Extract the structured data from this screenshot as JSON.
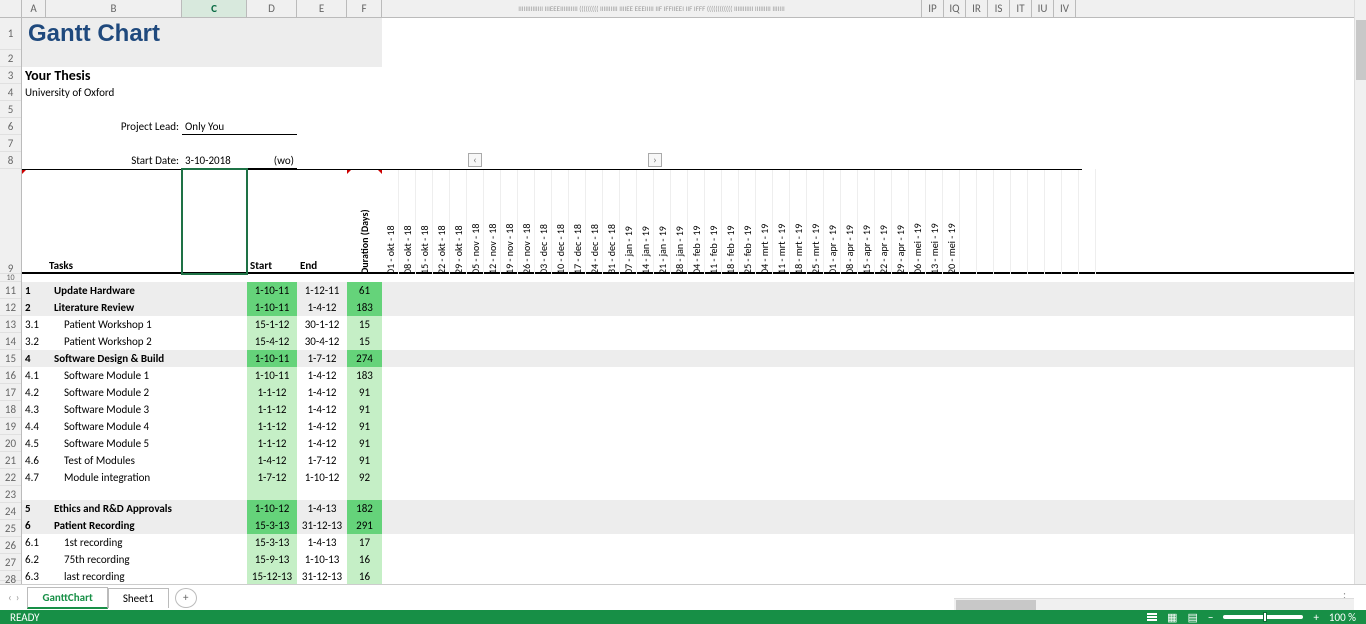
{
  "main_title": "Gantt Chart",
  "subtitle": "Your Thesis",
  "subsubtitle": "University of Oxford",
  "project_lead_label": "Project Lead:",
  "project_lead_value": "Only You",
  "start_date_label": "Start Date:",
  "start_date_value": "3-10-2018",
  "start_date_suffix": "(wo)",
  "headers": {
    "tasks": "Tasks",
    "start": "Start",
    "end": "End",
    "duration": "Duration (Days)"
  },
  "col_letters": [
    "A",
    "B",
    "C",
    "D",
    "E",
    "F"
  ],
  "col_far_letters": [
    "IP",
    "IQ",
    "IR",
    "IS",
    "IT",
    "IU",
    "IV"
  ],
  "row_numbers": [
    "1",
    "2",
    "3",
    "4",
    "5",
    "6",
    "7",
    "8",
    "9",
    "10",
    "11",
    "12",
    "13",
    "14",
    "15",
    "16",
    "17",
    "18",
    "19",
    "20",
    "21",
    "22",
    "23",
    "24",
    "25",
    "26",
    "27",
    "28"
  ],
  "scroll_left": "‹",
  "scroll_right": "›",
  "timeline_labels": [
    "01 - okt - 18",
    "08 - okt - 18",
    "15 - okt - 18",
    "22 - okt - 18",
    "29 - okt - 18",
    "05 - nov - 18",
    "12 - nov - 18",
    "19 - nov - 18",
    "26 - nov - 18",
    "03 - dec - 18",
    "10 - dec - 18",
    "17 - dec - 18",
    "24 - dec - 18",
    "31 - dec - 18",
    "07 - jan - 19",
    "14 - jan - 19",
    "21 - jan - 19",
    "28 - jan - 19",
    "04 - feb - 19",
    "11 - feb - 19",
    "18 - feb - 19",
    "25 - feb - 19",
    "04 - mrt - 19",
    "11 - mrt - 19",
    "18 - mrt - 19",
    "25 - mrt - 19",
    "01 - apr - 19",
    "08 - apr - 19",
    "15 - apr - 19",
    "22 - apr - 19",
    "29 - apr - 19",
    "06 - mei - 19",
    "13 - mei - 19",
    "20 - mei - 19"
  ],
  "rows": [
    {
      "n": "1",
      "task": "Update Hardware",
      "start": "1-10-11",
      "end": "1-12-11",
      "dur": "61",
      "bold": true,
      "grey": true,
      "greendark": true
    },
    {
      "n": "2",
      "task": "Literature Review",
      "start": "1-10-11",
      "end": "1-4-12",
      "dur": "183",
      "bold": true,
      "grey": true,
      "greendark": true
    },
    {
      "n": "3.1",
      "task": "Patient Workshop 1",
      "start": "15-1-12",
      "end": "30-1-12",
      "dur": "15",
      "bold": false,
      "grey": false,
      "greendark": false
    },
    {
      "n": "3.2",
      "task": "Patient Workshop 2",
      "start": "15-4-12",
      "end": "30-4-12",
      "dur": "15",
      "bold": false,
      "grey": false,
      "greendark": false
    },
    {
      "n": "4",
      "task": "Software Design & Build",
      "start": "1-10-11",
      "end": "1-7-12",
      "dur": "274",
      "bold": true,
      "grey": true,
      "greendark": true
    },
    {
      "n": "4.1",
      "task": "Software Module 1",
      "start": "1-10-11",
      "end": "1-4-12",
      "dur": "183",
      "bold": false,
      "grey": false,
      "greendark": false
    },
    {
      "n": "4.2",
      "task": "Software Module 2",
      "start": "1-1-12",
      "end": "1-4-12",
      "dur": "91",
      "bold": false,
      "grey": false,
      "greendark": false
    },
    {
      "n": "4.3",
      "task": "Software Module 3",
      "start": "1-1-12",
      "end": "1-4-12",
      "dur": "91",
      "bold": false,
      "grey": false,
      "greendark": false
    },
    {
      "n": "4.4",
      "task": "Software Module 4",
      "start": "1-1-12",
      "end": "1-4-12",
      "dur": "91",
      "bold": false,
      "grey": false,
      "greendark": false
    },
    {
      "n": "4.5",
      "task": "Software Module 5",
      "start": "1-1-12",
      "end": "1-4-12",
      "dur": "91",
      "bold": false,
      "grey": false,
      "greendark": false
    },
    {
      "n": "4.6",
      "task": "Test of Modules",
      "start": "1-4-12",
      "end": "1-7-12",
      "dur": "91",
      "bold": false,
      "grey": false,
      "greendark": false
    },
    {
      "n": "4.7",
      "task": "Module integration",
      "start": "1-7-12",
      "end": "1-10-12",
      "dur": "92",
      "bold": false,
      "grey": false,
      "greendark": false
    },
    {
      "n": "5",
      "task": "Ethics and R&D Approvals",
      "start": "1-10-12",
      "end": "1-4-13",
      "dur": "182",
      "bold": true,
      "grey": true,
      "greendark": true
    },
    {
      "n": "6",
      "task": "Patient Recording",
      "start": "15-3-13",
      "end": "31-12-13",
      "dur": "291",
      "bold": true,
      "grey": true,
      "greendark": true
    },
    {
      "n": "6.1",
      "task": "1st  recording",
      "start": "15-3-13",
      "end": "1-4-13",
      "dur": "17",
      "bold": false,
      "grey": false,
      "greendark": false
    },
    {
      "n": "6.2",
      "task": "75th recording",
      "start": "15-9-13",
      "end": "1-10-13",
      "dur": "16",
      "bold": false,
      "grey": false,
      "greendark": false
    },
    {
      "n": "6.3",
      "task": "last recording",
      "start": "15-12-13",
      "end": "31-12-13",
      "dur": "16",
      "bold": false,
      "grey": false,
      "greendark": false,
      "partial": true
    }
  ],
  "tabs": {
    "active": "GanttChart",
    "other": "Sheet1",
    "add": "+"
  },
  "status": {
    "ready": "READY",
    "zoom": "100 %",
    "minus": "−",
    "plus": "+"
  },
  "tabnav": {
    "first": "◄",
    "prev": "‹",
    "next": "›",
    "last": "►"
  }
}
